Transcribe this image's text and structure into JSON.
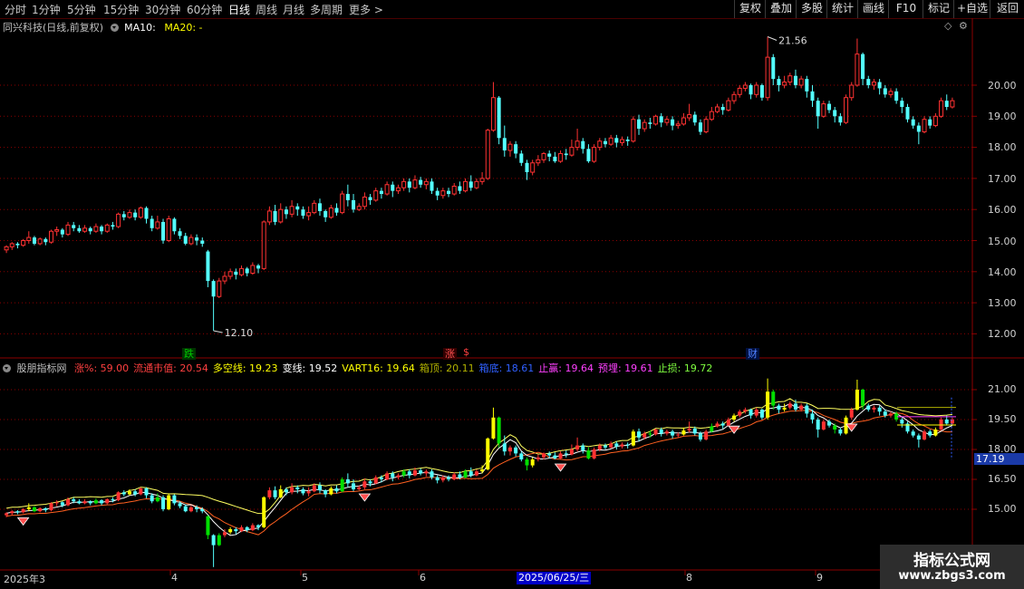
{
  "toolbar": {
    "periods": [
      "分时",
      "1分钟",
      "5分钟",
      "15分钟",
      "30分钟",
      "60分钟",
      "日线",
      "周线",
      "月线",
      "多周期",
      "更多 >"
    ],
    "active_period": "日线",
    "right_buttons": [
      "复权",
      "叠加",
      "多股",
      "统计",
      "画线",
      "F10",
      "标记",
      "+自选",
      "返回"
    ]
  },
  "main_panel": {
    "title": "同兴科技(日线,前复权)",
    "ma10_label": "MA10:",
    "ma20_label": "MA20: -",
    "high_annotation": "21.56",
    "low_annotation": "12.10",
    "price_ticks": [
      "20.00",
      "19.00",
      "18.00",
      "17.00",
      "16.00",
      "15.00",
      "14.00",
      "13.00",
      "12.00"
    ],
    "markers": [
      {
        "text": "跌",
        "color": "#00c800",
        "bg": "#003300"
      },
      {
        "text": "涨",
        "color": "#ff5050",
        "bg": "#330000"
      },
      {
        "text": "财",
        "color": "#5080ff",
        "bg": "#001040"
      }
    ],
    "dollar_marker": "$"
  },
  "indicator_panel": {
    "name": "股朋指标网",
    "fields": [
      {
        "label": "涨%:",
        "value": "59.00",
        "color": "#ff4040"
      },
      {
        "label": "流通市值:",
        "value": "20.54",
        "color": "#ff4040"
      },
      {
        "label": "多空线:",
        "value": "19.23",
        "color": "#ffff00"
      },
      {
        "label": "变线:",
        "value": "19.52",
        "color": "#ffffff"
      },
      {
        "label": "VART16:",
        "value": "19.64",
        "color": "#ffff00"
      },
      {
        "label": "箱顶:",
        "value": "20.11",
        "color": "#b0b000"
      },
      {
        "label": "箱底:",
        "value": "18.61",
        "color": "#3060ff"
      },
      {
        "label": "止赢:",
        "value": "19.64",
        "color": "#ff40ff"
      },
      {
        "label": "预埋:",
        "value": "19.61",
        "color": "#ff40ff"
      },
      {
        "label": "止损:",
        "value": "19.72",
        "color": "#80ff40"
      }
    ],
    "price_ticks": [
      "21.00",
      "19.50",
      "18.00",
      "16.50",
      "15.00"
    ],
    "current_price_badge": "17.19"
  },
  "time_axis": {
    "labels": [
      "2025年3",
      "4",
      "5",
      "6",
      "8",
      "9"
    ],
    "cursor_date": "2025/06/25/三"
  },
  "watermark": {
    "line1": "指标公式网",
    "line2": "www.zbgs3.com"
  },
  "colors": {
    "up": "#ff3232",
    "down": "#54ffff",
    "grid": "#8b0000",
    "background": "#000000"
  },
  "chart_data": {
    "type": "candlestick",
    "price_range": [
      11.5,
      22.0
    ],
    "candles": [
      [
        14.7,
        14.8,
        14.6,
        14.85
      ],
      [
        14.8,
        14.9,
        14.7,
        14.95
      ],
      [
        14.9,
        14.85,
        14.75,
        14.95
      ],
      [
        14.85,
        15.0,
        14.8,
        15.05
      ],
      [
        15.0,
        15.1,
        14.9,
        15.3
      ],
      [
        15.1,
        14.9,
        14.85,
        15.15
      ],
      [
        14.9,
        15.05,
        14.85,
        15.1
      ],
      [
        15.05,
        14.95,
        14.85,
        15.1
      ],
      [
        14.95,
        15.3,
        14.9,
        15.35
      ],
      [
        15.3,
        15.35,
        15.15,
        15.45
      ],
      [
        15.35,
        15.2,
        15.1,
        15.4
      ],
      [
        15.2,
        15.5,
        15.15,
        15.6
      ],
      [
        15.5,
        15.4,
        15.3,
        15.6
      ],
      [
        15.4,
        15.3,
        15.25,
        15.5
      ],
      [
        15.3,
        15.4,
        15.25,
        15.5
      ],
      [
        15.4,
        15.3,
        15.2,
        15.45
      ],
      [
        15.3,
        15.45,
        15.25,
        15.55
      ],
      [
        15.45,
        15.3,
        15.2,
        15.5
      ],
      [
        15.3,
        15.5,
        15.25,
        15.55
      ],
      [
        15.5,
        15.45,
        15.35,
        15.6
      ],
      [
        15.45,
        15.85,
        15.4,
        15.9
      ],
      [
        15.85,
        15.75,
        15.65,
        15.95
      ],
      [
        15.75,
        15.9,
        15.7,
        16.0
      ],
      [
        15.9,
        15.75,
        15.65,
        16.0
      ],
      [
        15.75,
        16.05,
        15.7,
        16.1
      ],
      [
        16.05,
        15.7,
        15.55,
        16.1
      ],
      [
        15.7,
        15.4,
        15.3,
        15.8
      ],
      [
        15.4,
        15.6,
        15.35,
        15.8
      ],
      [
        15.6,
        15.0,
        14.9,
        15.7
      ],
      [
        15.0,
        15.7,
        14.95,
        15.8
      ],
      [
        15.7,
        15.3,
        15.2,
        15.75
      ],
      [
        15.3,
        15.15,
        15.05,
        15.4
      ],
      [
        15.15,
        14.9,
        14.85,
        15.25
      ],
      [
        14.9,
        15.1,
        14.85,
        15.2
      ],
      [
        15.1,
        15.0,
        14.85,
        15.2
      ],
      [
        15.0,
        14.9,
        14.8,
        15.1
      ],
      [
        14.65,
        13.7,
        13.5,
        14.7
      ],
      [
        13.7,
        13.2,
        12.1,
        13.75
      ],
      [
        13.2,
        13.7,
        13.15,
        13.8
      ],
      [
        13.7,
        13.85,
        13.6,
        14.0
      ],
      [
        13.85,
        14.0,
        13.75,
        14.1
      ],
      [
        14.0,
        13.9,
        13.75,
        14.1
      ],
      [
        13.9,
        14.1,
        13.85,
        14.2
      ],
      [
        14.1,
        13.95,
        13.85,
        14.15
      ],
      [
        13.95,
        14.2,
        13.9,
        14.3
      ],
      [
        14.2,
        14.1,
        13.95,
        14.25
      ],
      [
        14.1,
        15.6,
        14.05,
        15.65
      ],
      [
        15.6,
        15.95,
        15.5,
        16.1
      ],
      [
        15.95,
        15.6,
        15.5,
        16.15
      ],
      [
        15.6,
        16.0,
        15.55,
        16.2
      ],
      [
        16.0,
        15.85,
        15.7,
        16.1
      ],
      [
        15.85,
        16.1,
        15.75,
        16.3
      ],
      [
        16.1,
        16.0,
        15.8,
        16.2
      ],
      [
        16.0,
        15.8,
        15.7,
        16.1
      ],
      [
        15.8,
        15.9,
        15.65,
        16.1
      ],
      [
        15.9,
        16.2,
        15.85,
        16.3
      ],
      [
        16.2,
        15.95,
        15.8,
        16.35
      ],
      [
        15.95,
        15.75,
        15.6,
        16.0
      ],
      [
        15.75,
        16.05,
        15.7,
        16.15
      ],
      [
        16.05,
        15.9,
        15.8,
        16.2
      ],
      [
        15.9,
        16.5,
        15.85,
        16.6
      ],
      [
        16.5,
        16.3,
        16.1,
        16.8
      ],
      [
        16.3,
        16.0,
        15.9,
        16.5
      ],
      [
        16.0,
        16.1,
        15.95,
        16.2
      ],
      [
        16.1,
        16.4,
        16.0,
        16.55
      ],
      [
        16.4,
        16.3,
        16.15,
        16.5
      ],
      [
        16.3,
        16.6,
        16.25,
        16.7
      ],
      [
        16.6,
        16.5,
        16.35,
        16.7
      ],
      [
        16.5,
        16.8,
        16.45,
        16.9
      ],
      [
        16.8,
        16.6,
        16.4,
        16.9
      ],
      [
        16.6,
        16.7,
        16.5,
        16.8
      ],
      [
        16.7,
        16.9,
        16.6,
        17.0
      ],
      [
        16.9,
        16.7,
        16.55,
        17.0
      ],
      [
        16.7,
        16.95,
        16.65,
        17.1
      ],
      [
        16.95,
        16.8,
        16.7,
        17.05
      ],
      [
        16.8,
        16.9,
        16.65,
        17.0
      ],
      [
        16.9,
        16.6,
        16.5,
        17.0
      ],
      [
        16.6,
        16.45,
        16.3,
        16.7
      ],
      [
        16.45,
        16.6,
        16.35,
        16.7
      ],
      [
        16.6,
        16.5,
        16.4,
        16.7
      ],
      [
        16.5,
        16.75,
        16.45,
        16.85
      ],
      [
        16.75,
        16.6,
        16.5,
        16.9
      ],
      [
        16.6,
        16.9,
        16.55,
        17.0
      ],
      [
        16.9,
        16.7,
        16.6,
        17.1
      ],
      [
        16.7,
        16.9,
        16.65,
        17.0
      ],
      [
        16.9,
        17.0,
        16.8,
        17.2
      ],
      [
        17.0,
        18.55,
        16.95,
        18.6
      ],
      [
        18.55,
        19.6,
        18.5,
        20.1
      ],
      [
        19.6,
        18.3,
        18.1,
        19.65
      ],
      [
        18.3,
        17.9,
        17.7,
        18.7
      ],
      [
        17.9,
        18.1,
        17.7,
        18.2
      ],
      [
        18.1,
        17.8,
        17.65,
        18.2
      ],
      [
        17.8,
        17.5,
        17.4,
        17.9
      ],
      [
        17.5,
        17.2,
        16.95,
        17.6
      ],
      [
        17.2,
        17.5,
        17.1,
        17.6
      ],
      [
        17.5,
        17.6,
        17.4,
        17.75
      ],
      [
        17.6,
        17.8,
        17.5,
        17.85
      ],
      [
        17.8,
        17.7,
        17.55,
        17.9
      ],
      [
        17.7,
        17.55,
        17.5,
        17.85
      ],
      [
        17.55,
        17.8,
        17.5,
        17.9
      ],
      [
        17.8,
        17.75,
        17.6,
        17.95
      ],
      [
        17.75,
        18.0,
        17.7,
        18.25
      ],
      [
        18.0,
        18.2,
        17.9,
        18.6
      ],
      [
        18.2,
        17.95,
        17.8,
        18.3
      ],
      [
        17.95,
        17.55,
        17.5,
        18.1
      ],
      [
        17.55,
        18.0,
        17.5,
        18.1
      ],
      [
        18.0,
        18.2,
        17.9,
        18.3
      ],
      [
        18.2,
        18.1,
        18.0,
        18.3
      ],
      [
        18.1,
        18.3,
        18.05,
        18.4
      ],
      [
        18.3,
        18.15,
        18.0,
        18.4
      ],
      [
        18.15,
        18.25,
        18.05,
        18.35
      ],
      [
        18.25,
        18.2,
        18.05,
        18.35
      ],
      [
        18.2,
        18.9,
        18.15,
        19.0
      ],
      [
        18.9,
        18.6,
        18.4,
        19.05
      ],
      [
        18.6,
        18.8,
        18.5,
        18.9
      ],
      [
        18.8,
        18.75,
        18.6,
        18.95
      ],
      [
        18.75,
        19.0,
        18.7,
        19.05
      ],
      [
        19.0,
        18.8,
        18.65,
        19.1
      ],
      [
        18.8,
        18.9,
        18.7,
        19.0
      ],
      [
        18.9,
        18.7,
        18.55,
        19.0
      ],
      [
        18.7,
        18.75,
        18.6,
        18.85
      ],
      [
        18.75,
        18.95,
        18.7,
        19.1
      ],
      [
        18.95,
        19.05,
        18.85,
        19.4
      ],
      [
        19.05,
        18.8,
        18.7,
        19.15
      ],
      [
        18.8,
        18.5,
        18.4,
        18.9
      ],
      [
        18.5,
        18.9,
        18.45,
        19.0
      ],
      [
        18.9,
        19.15,
        18.85,
        19.3
      ],
      [
        19.15,
        19.3,
        19.1,
        19.4
      ],
      [
        19.3,
        19.2,
        19.05,
        19.4
      ],
      [
        19.2,
        19.5,
        19.15,
        19.6
      ],
      [
        19.5,
        19.7,
        19.4,
        19.8
      ],
      [
        19.7,
        19.9,
        19.6,
        20.0
      ],
      [
        19.9,
        20.0,
        19.8,
        20.1
      ],
      [
        20.0,
        19.7,
        19.55,
        20.05
      ],
      [
        19.7,
        20.0,
        19.6,
        20.1
      ],
      [
        20.0,
        19.6,
        19.5,
        20.05
      ],
      [
        19.6,
        20.9,
        19.5,
        21.56
      ],
      [
        20.9,
        20.2,
        20.0,
        21.0
      ],
      [
        20.2,
        20.0,
        19.8,
        20.3
      ],
      [
        20.0,
        20.1,
        19.9,
        20.3
      ],
      [
        20.1,
        20.3,
        20.0,
        20.4
      ],
      [
        20.3,
        20.0,
        19.9,
        20.5
      ],
      [
        20.0,
        20.2,
        19.9,
        20.3
      ],
      [
        20.2,
        19.8,
        19.6,
        20.3
      ],
      [
        19.8,
        19.5,
        19.3,
        20.0
      ],
      [
        19.5,
        19.0,
        18.6,
        19.6
      ],
      [
        19.0,
        19.4,
        18.95,
        19.5
      ],
      [
        19.4,
        19.2,
        19.1,
        19.5
      ],
      [
        19.2,
        19.0,
        18.8,
        19.3
      ],
      [
        19.0,
        18.8,
        18.7,
        19.1
      ],
      [
        18.8,
        19.6,
        18.75,
        19.7
      ],
      [
        19.6,
        20.0,
        19.5,
        20.1
      ],
      [
        20.0,
        21.0,
        19.95,
        21.5
      ],
      [
        21.0,
        20.2,
        20.0,
        21.05
      ],
      [
        20.2,
        20.0,
        19.9,
        20.3
      ],
      [
        20.0,
        20.1,
        19.85,
        20.2
      ],
      [
        20.1,
        19.9,
        19.7,
        20.2
      ],
      [
        19.9,
        19.7,
        19.6,
        20.0
      ],
      [
        19.7,
        19.8,
        19.6,
        19.9
      ],
      [
        19.8,
        19.5,
        19.4,
        19.9
      ],
      [
        19.5,
        19.3,
        19.1,
        19.6
      ],
      [
        19.3,
        18.9,
        18.8,
        19.4
      ],
      [
        18.9,
        18.7,
        18.6,
        19.0
      ],
      [
        18.7,
        18.5,
        18.1,
        18.8
      ],
      [
        18.5,
        18.9,
        18.45,
        19.0
      ],
      [
        18.9,
        18.7,
        18.6,
        19.0
      ],
      [
        18.7,
        19.0,
        18.65,
        19.1
      ],
      [
        19.0,
        19.5,
        18.95,
        19.6
      ],
      [
        19.5,
        19.3,
        19.2,
        19.7
      ],
      [
        19.3,
        19.5,
        19.25,
        19.6
      ]
    ]
  }
}
